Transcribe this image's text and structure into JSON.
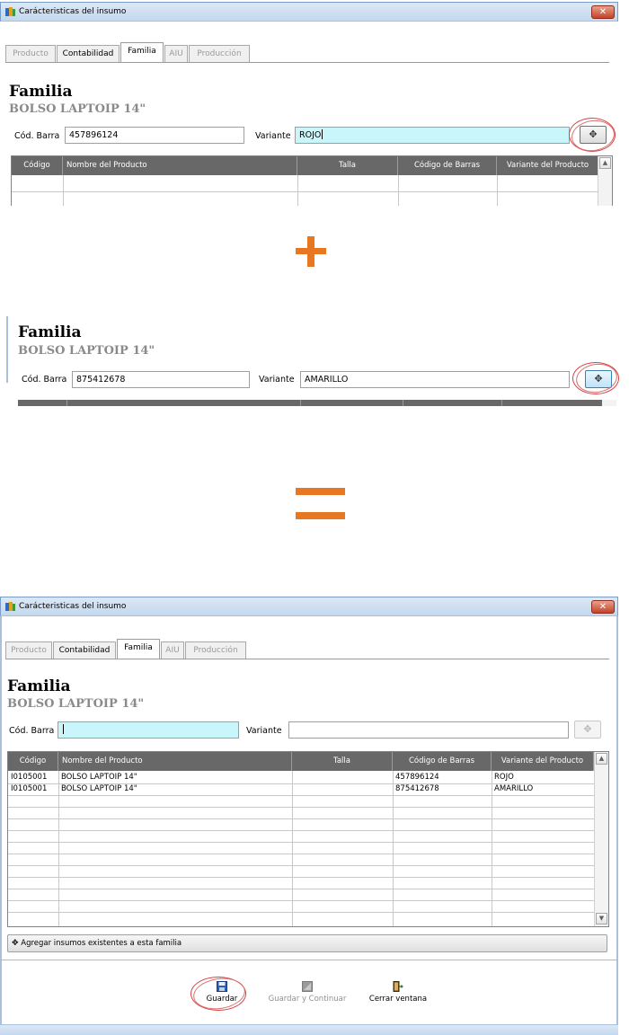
{
  "window": {
    "title": "Carácteristicas del insumo",
    "close": "✕"
  },
  "tabs": [
    "Producto",
    "Contabilidad",
    "Familia",
    "AIU",
    "Producción"
  ],
  "familia": {
    "heading": "Familia",
    "product": "BOLSO LAPTOIP 14\""
  },
  "form": {
    "barcode_label": "Cód. Barra",
    "variant_label": "Variante",
    "add_symbol": "✥"
  },
  "step1": {
    "barcode": "457896124",
    "variant": "ROJO"
  },
  "step2": {
    "barcode": "875412678",
    "variant": "AMARILLO"
  },
  "result": {
    "barcode": "",
    "variant": ""
  },
  "grid": {
    "columns": [
      "Código",
      "Nombre del Producto",
      "Talla",
      "Código de Barras",
      "Variante del Producto"
    ],
    "rows": [
      {
        "codigo": "I0105001",
        "nombre": "BOLSO LAPTOIP 14\"",
        "talla": "",
        "barras": "457896124",
        "variante": "ROJO"
      },
      {
        "codigo": "I0105001",
        "nombre": "BOLSO LAPTOIP 14\"",
        "talla": "",
        "barras": "875412678",
        "variante": "AMARILLO"
      }
    ]
  },
  "add_existing": "Agregar insumos existentes a esta familia",
  "actions": {
    "save": "Guardar",
    "save_continue": "Guardar y Continuar",
    "close": "Cerrar ventana"
  },
  "colors": {
    "accent_orange": "#e87722",
    "focus_cyan": "#c9f6fb",
    "grid_header": "#686868",
    "highlight_ring": "#d94040"
  },
  "icons": {
    "plus": "plus-symbol-icon",
    "equals": "equals-symbol-icon",
    "save": "floppy-disk-icon",
    "save_continue": "floppy-disk-disabled-icon",
    "close": "exit-door-icon"
  }
}
